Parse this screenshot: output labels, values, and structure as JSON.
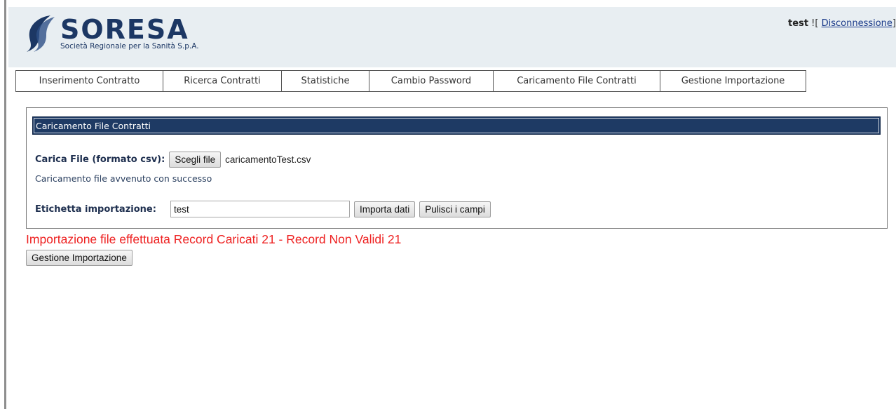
{
  "header": {
    "logo_name": "SORESA",
    "logo_subtitle": "Società Regionale per la Sanità S.p.A.",
    "user": "test",
    "user_suffix": " ![ ",
    "logout_label": "Disconnessione",
    "logout_suffix": "]"
  },
  "nav": {
    "tabs": [
      {
        "label": "Inserimento Contratto"
      },
      {
        "label": "Ricerca Contratti"
      },
      {
        "label": "Statistiche"
      },
      {
        "label": "Cambio Password"
      },
      {
        "label": "Caricamento File Contratti"
      },
      {
        "label": "Gestione Importazione"
      }
    ]
  },
  "panel": {
    "title": "Caricamento File Contratti",
    "file_label": "Carica File (formato csv):",
    "file_button": "Scegli file",
    "file_name": "caricamentoTest.csv",
    "success_message": "Caricamento file avvenuto con successo",
    "import_label": "Etichetta importazione:",
    "import_value": "test",
    "import_button": "Importa dati",
    "clear_button": "Pulisci i campi"
  },
  "result": {
    "message": "Importazione file effettuata Record Caricati 21 - Record Non Validi 21",
    "manage_button": "Gestione Importazione"
  },
  "colors": {
    "brand": "#1c3764",
    "panel_title_bg": "#1e3a64",
    "error_text": "#ee2222",
    "header_bg": "#e8eef2"
  }
}
